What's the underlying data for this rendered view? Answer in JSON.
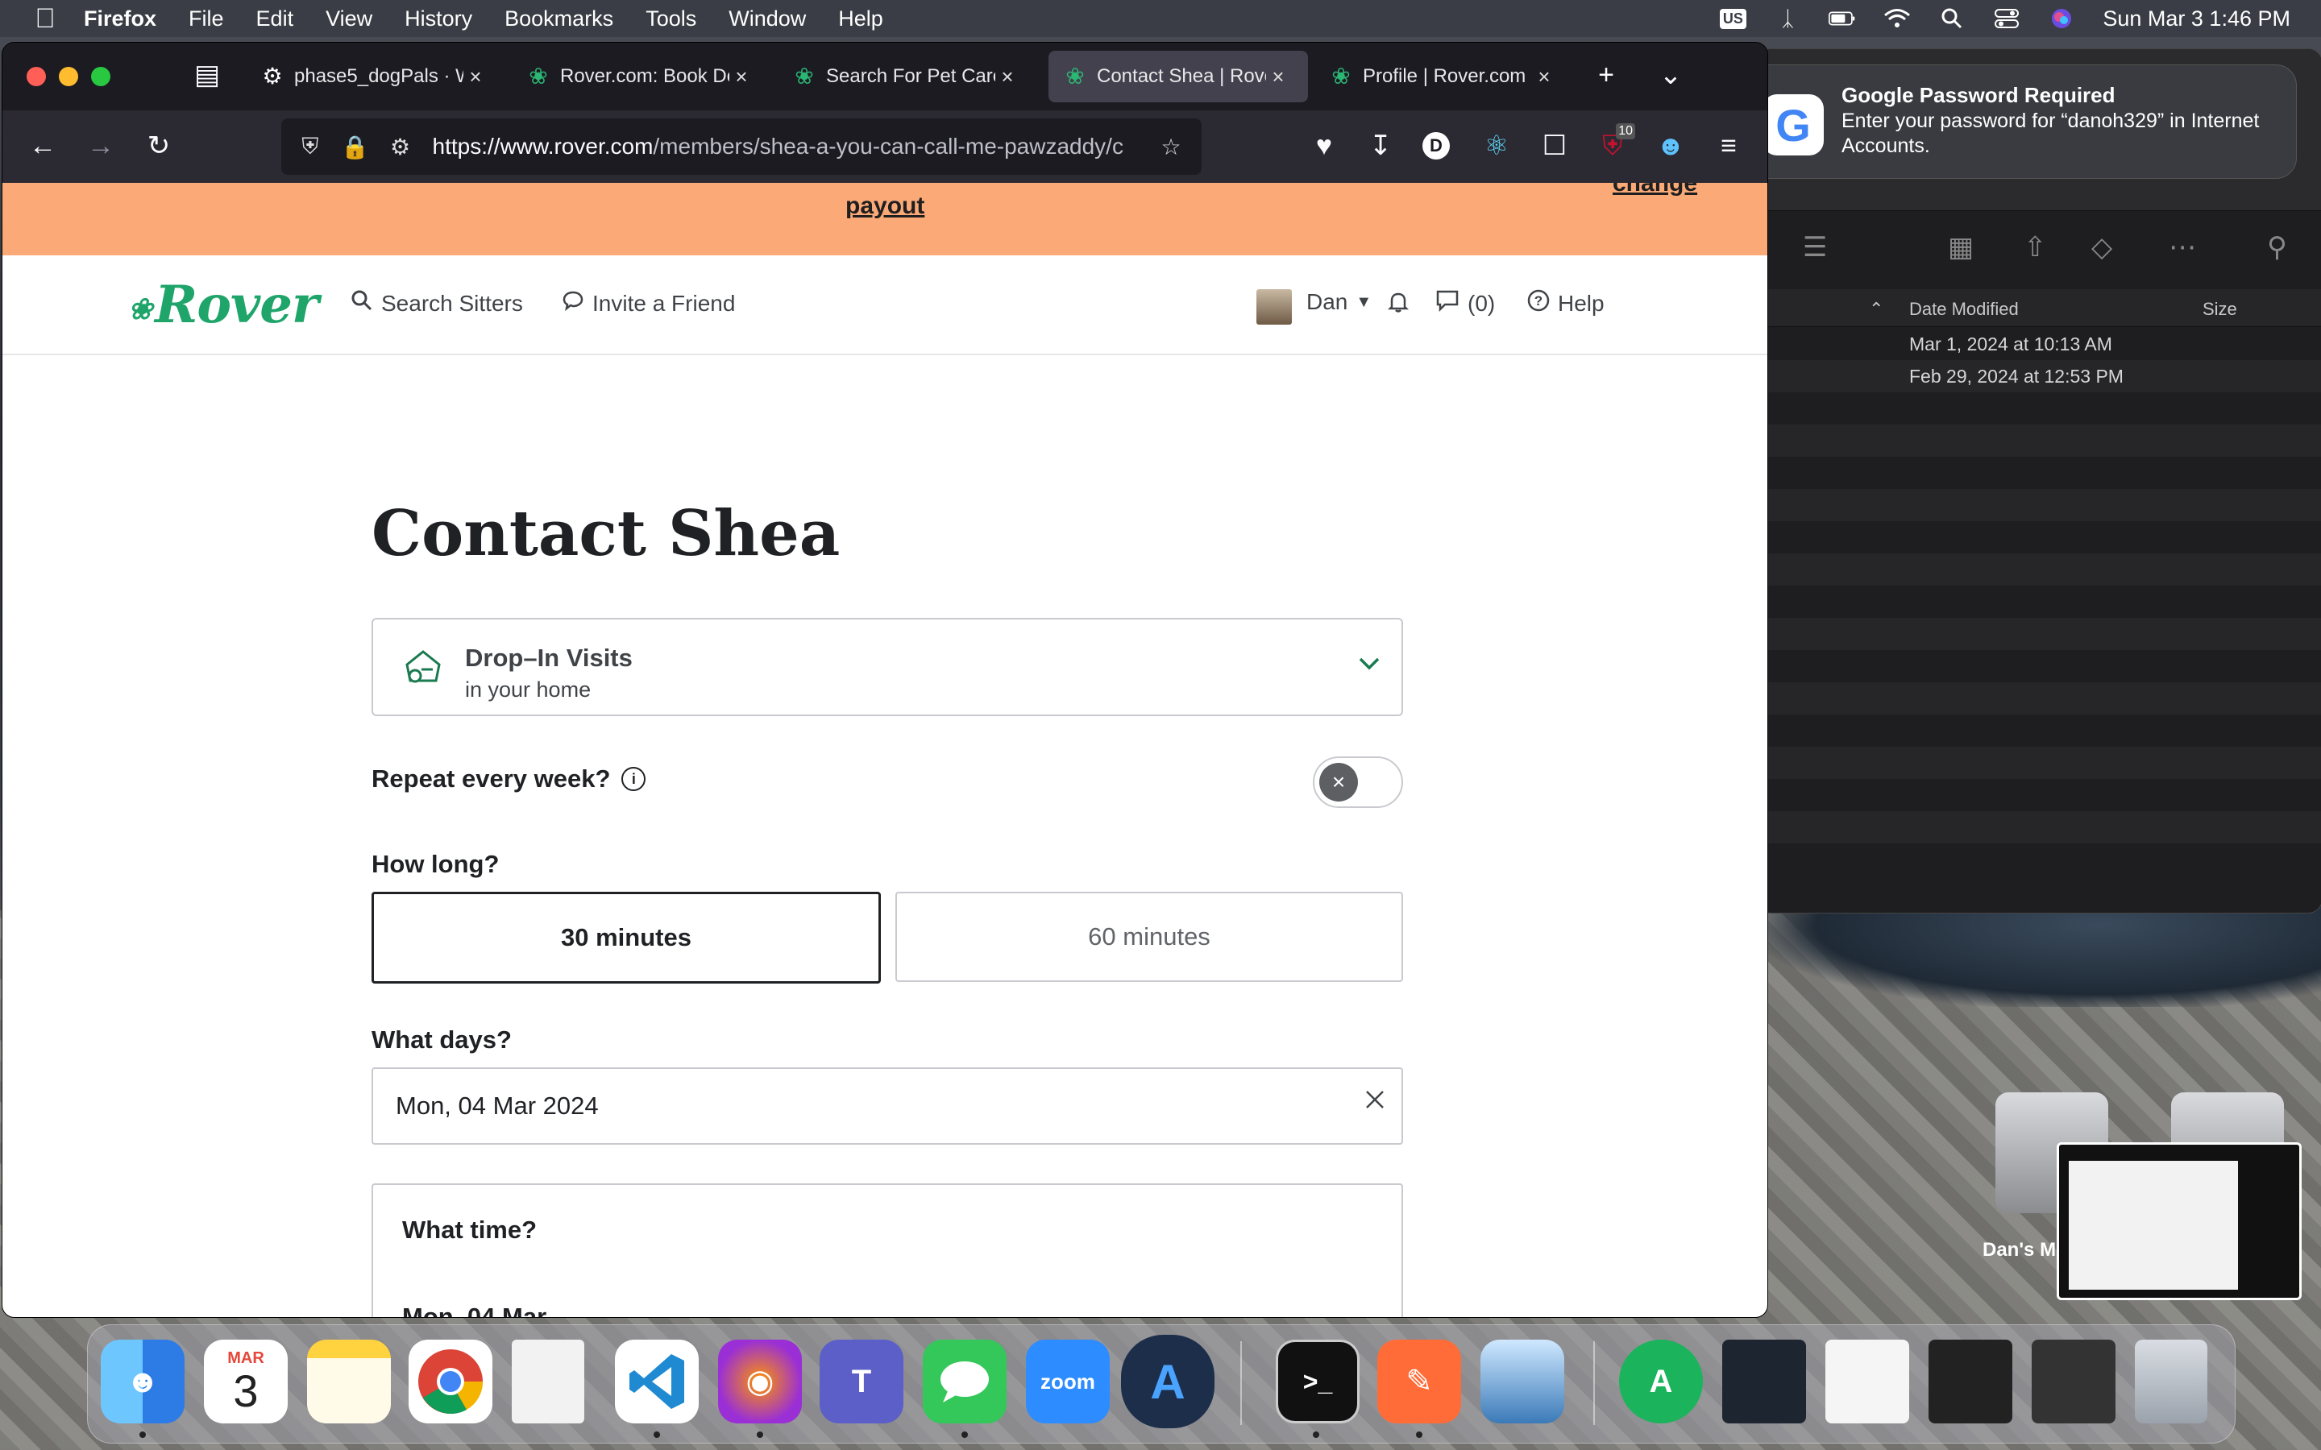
{
  "menubar": {
    "app": "Firefox",
    "items": [
      "File",
      "Edit",
      "View",
      "History",
      "Bookmarks",
      "Tools",
      "Window",
      "Help"
    ],
    "input_source": "US",
    "clock": "Sun Mar 3  1:46 PM"
  },
  "notification": {
    "title": "Google Password Required",
    "body": "Enter your password for “danoh329” in Internet Accounts."
  },
  "finder": {
    "col_date": "Date Modified",
    "col_size": "Size",
    "rows": [
      "Mar 1, 2024 at 10:13 AM",
      "Feb 29, 2024 at 12:53 PM"
    ],
    "disk_label": "Dan's M"
  },
  "browser": {
    "tabs": [
      {
        "label": "phase5_dogPals · W",
        "icon": "github-icon"
      },
      {
        "label": "Rover.com: Book Do",
        "icon": "paw-icon"
      },
      {
        "label": "Search For Pet Care",
        "icon": "paw-icon"
      },
      {
        "label": "Contact Shea | Rove",
        "icon": "paw-icon",
        "active": true
      },
      {
        "label": "Profile | Rover.com",
        "icon": "paw-icon"
      }
    ],
    "url_host": "https://www.rover.com",
    "url_path": "/members/shea-a-you-can-call-me-pawzaddy/c",
    "badge_count": "10"
  },
  "page": {
    "banner_link": "payout",
    "banner_hint": "change",
    "logo": "Rover",
    "nav": {
      "search": "Search Sitters",
      "invite": "Invite a Friend",
      "user": "Dan",
      "messages": "(0)",
      "help": "Help"
    },
    "title": "Contact Shea",
    "service": {
      "name": "Drop–In Visits",
      "sub": "in your home"
    },
    "repeat_label": "Repeat every week?",
    "how_long_label": "How long?",
    "durations": [
      "30 minutes",
      "60 minutes"
    ],
    "what_days_label": "What days?",
    "date_value": "Mon, 04 Mar 2024",
    "what_time_label": "What time?",
    "time_day": "Mon, 04 Mar"
  },
  "dock": {
    "calendar_month": "MAR",
    "calendar_day": "3",
    "zoom_label": "zoom"
  }
}
